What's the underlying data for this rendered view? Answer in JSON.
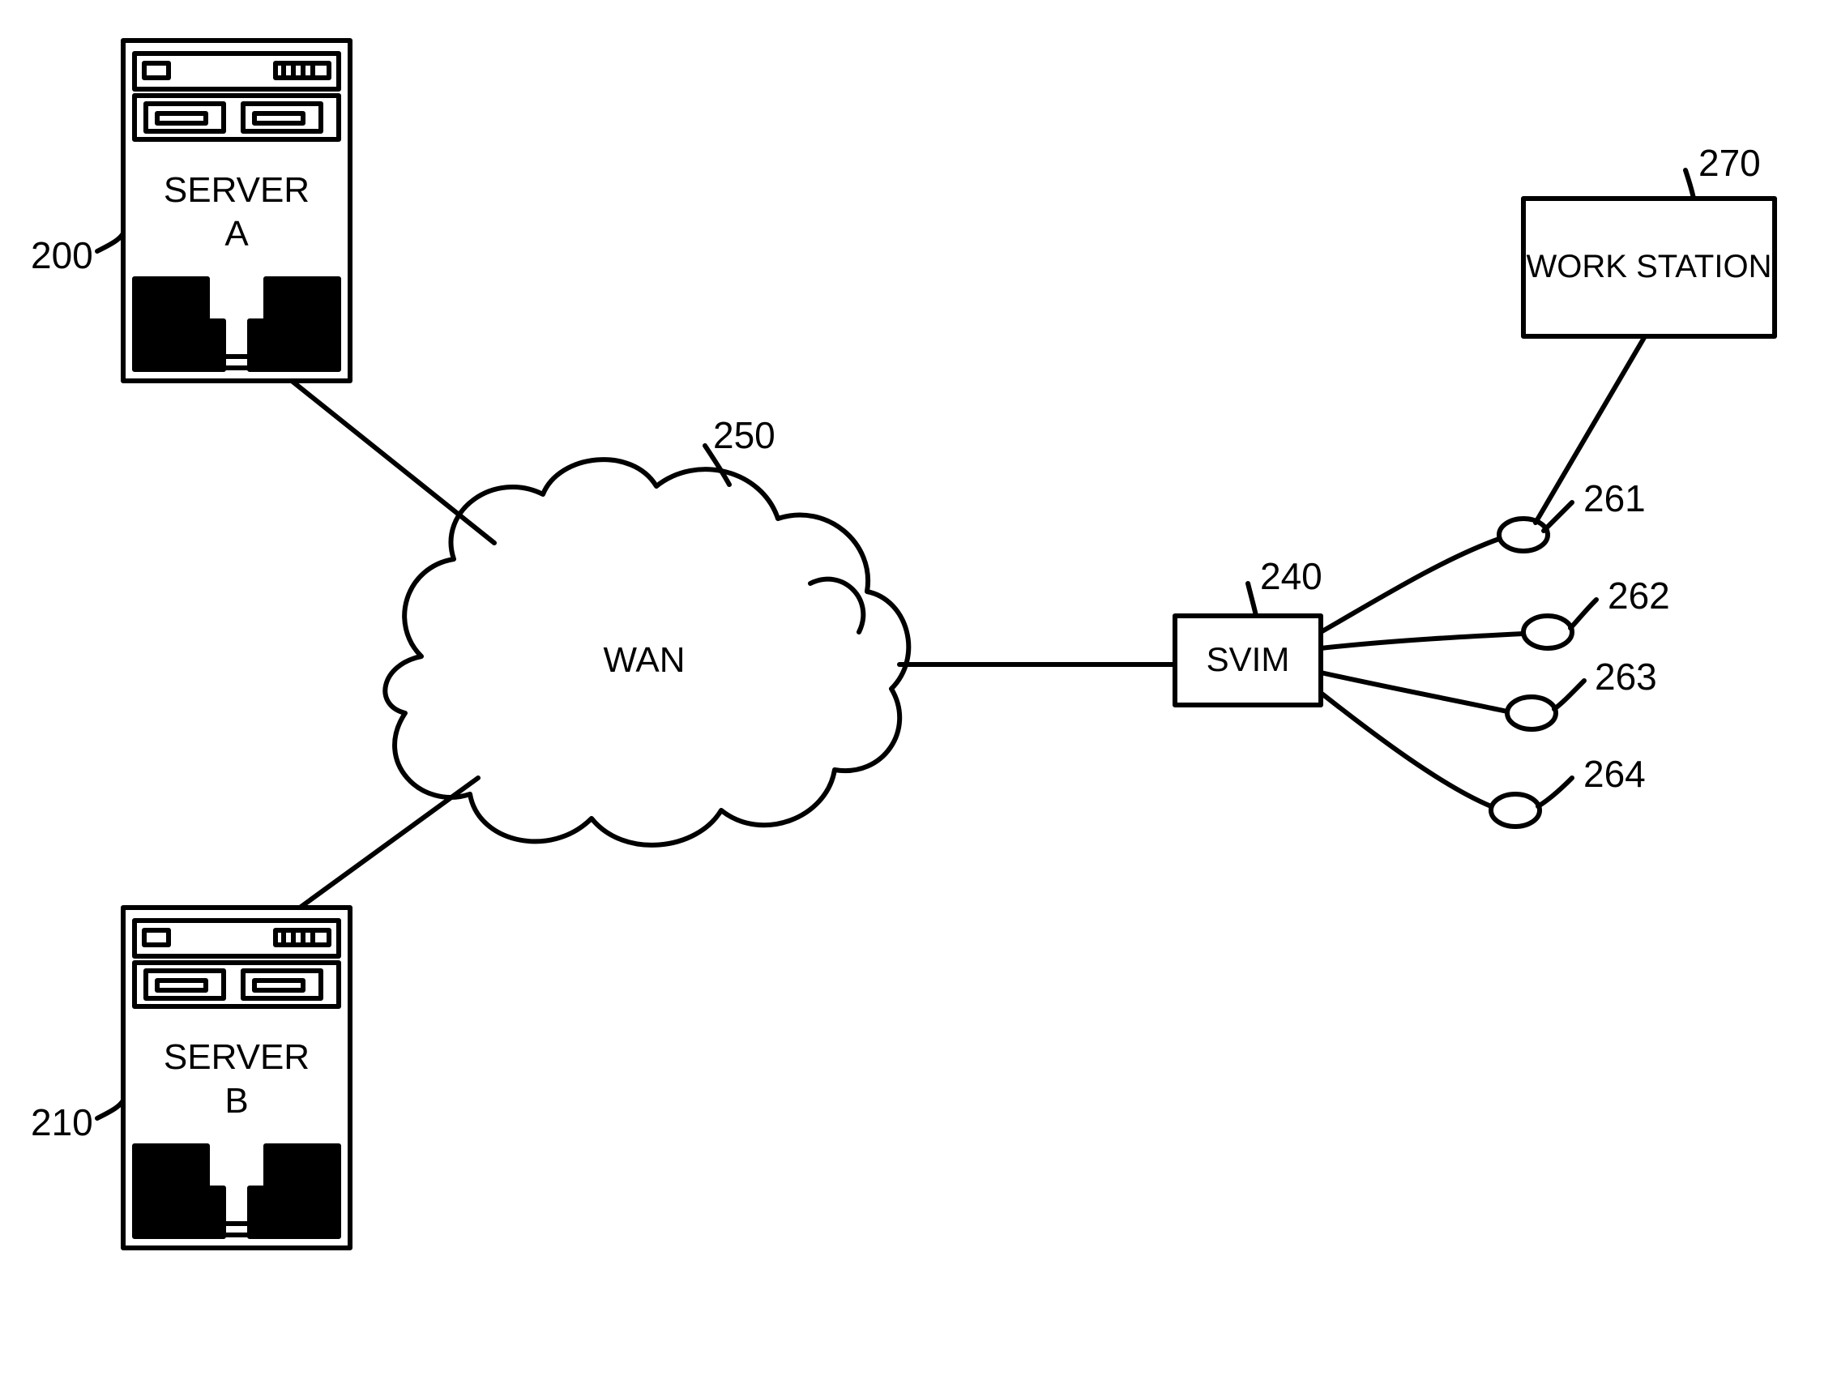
{
  "refs": {
    "serverA": "200",
    "serverB": "210",
    "wan": "250",
    "svim": "240",
    "workstation": "270",
    "port1": "261",
    "port2": "262",
    "port3": "263",
    "port4": "264"
  },
  "labels": {
    "serverA_line1": "SERVER",
    "serverA_line2": "A",
    "serverB_line1": "SERVER",
    "serverB_line2": "B",
    "wan": "WAN",
    "svim": "SVIM",
    "workstation": "WORK STATION"
  }
}
